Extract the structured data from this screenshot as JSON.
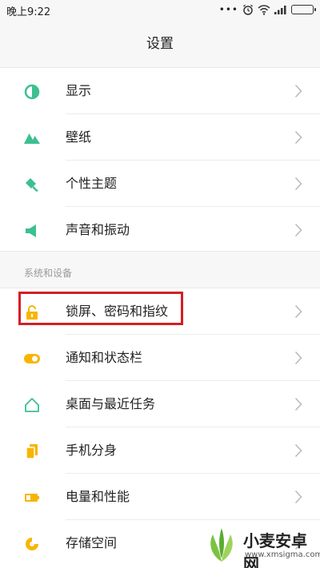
{
  "status_bar": {
    "time": "晚上9:22",
    "dots": "•••"
  },
  "header": {
    "title": "设置"
  },
  "colors": {
    "accent_green": "#3cc08f",
    "accent_yellow": "#f8b500",
    "highlight_red": "#d21f25"
  },
  "group_display": {
    "items": [
      {
        "label": "显示",
        "icon": "display-contrast-icon"
      },
      {
        "label": "壁纸",
        "icon": "wallpaper-mountain-icon"
      },
      {
        "label": "个性主题",
        "icon": "theme-brush-icon"
      },
      {
        "label": "声音和振动",
        "icon": "speaker-icon"
      }
    ]
  },
  "group_system": {
    "section_label": "系统和设备",
    "items": [
      {
        "label": "锁屏、密码和指纹",
        "icon": "lock-icon"
      },
      {
        "label": "通知和状态栏",
        "icon": "toggle-notification-icon"
      },
      {
        "label": "桌面与最近任务",
        "icon": "home-icon"
      },
      {
        "label": "手机分身",
        "icon": "second-space-icon"
      },
      {
        "label": "电量和性能",
        "icon": "battery-icon"
      },
      {
        "label": "存储空间",
        "icon": "storage-pie-icon"
      }
    ]
  },
  "watermark": {
    "text": "小麦安卓网",
    "url_text": "www.xmsigma.com"
  }
}
